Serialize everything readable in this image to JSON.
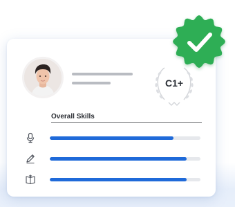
{
  "profile": {
    "level": "C1+"
  },
  "skills": {
    "title": "Overall Skills",
    "items": [
      {
        "icon": "microphone-icon",
        "level": 0.82
      },
      {
        "icon": "pencil-icon",
        "level": 0.91
      },
      {
        "icon": "book-star-icon",
        "level": 0.91
      }
    ]
  },
  "colors": {
    "accent_blue": "#1f6ad9",
    "badge_green": "#2fae55",
    "track_gray": "#e6e8ec"
  }
}
